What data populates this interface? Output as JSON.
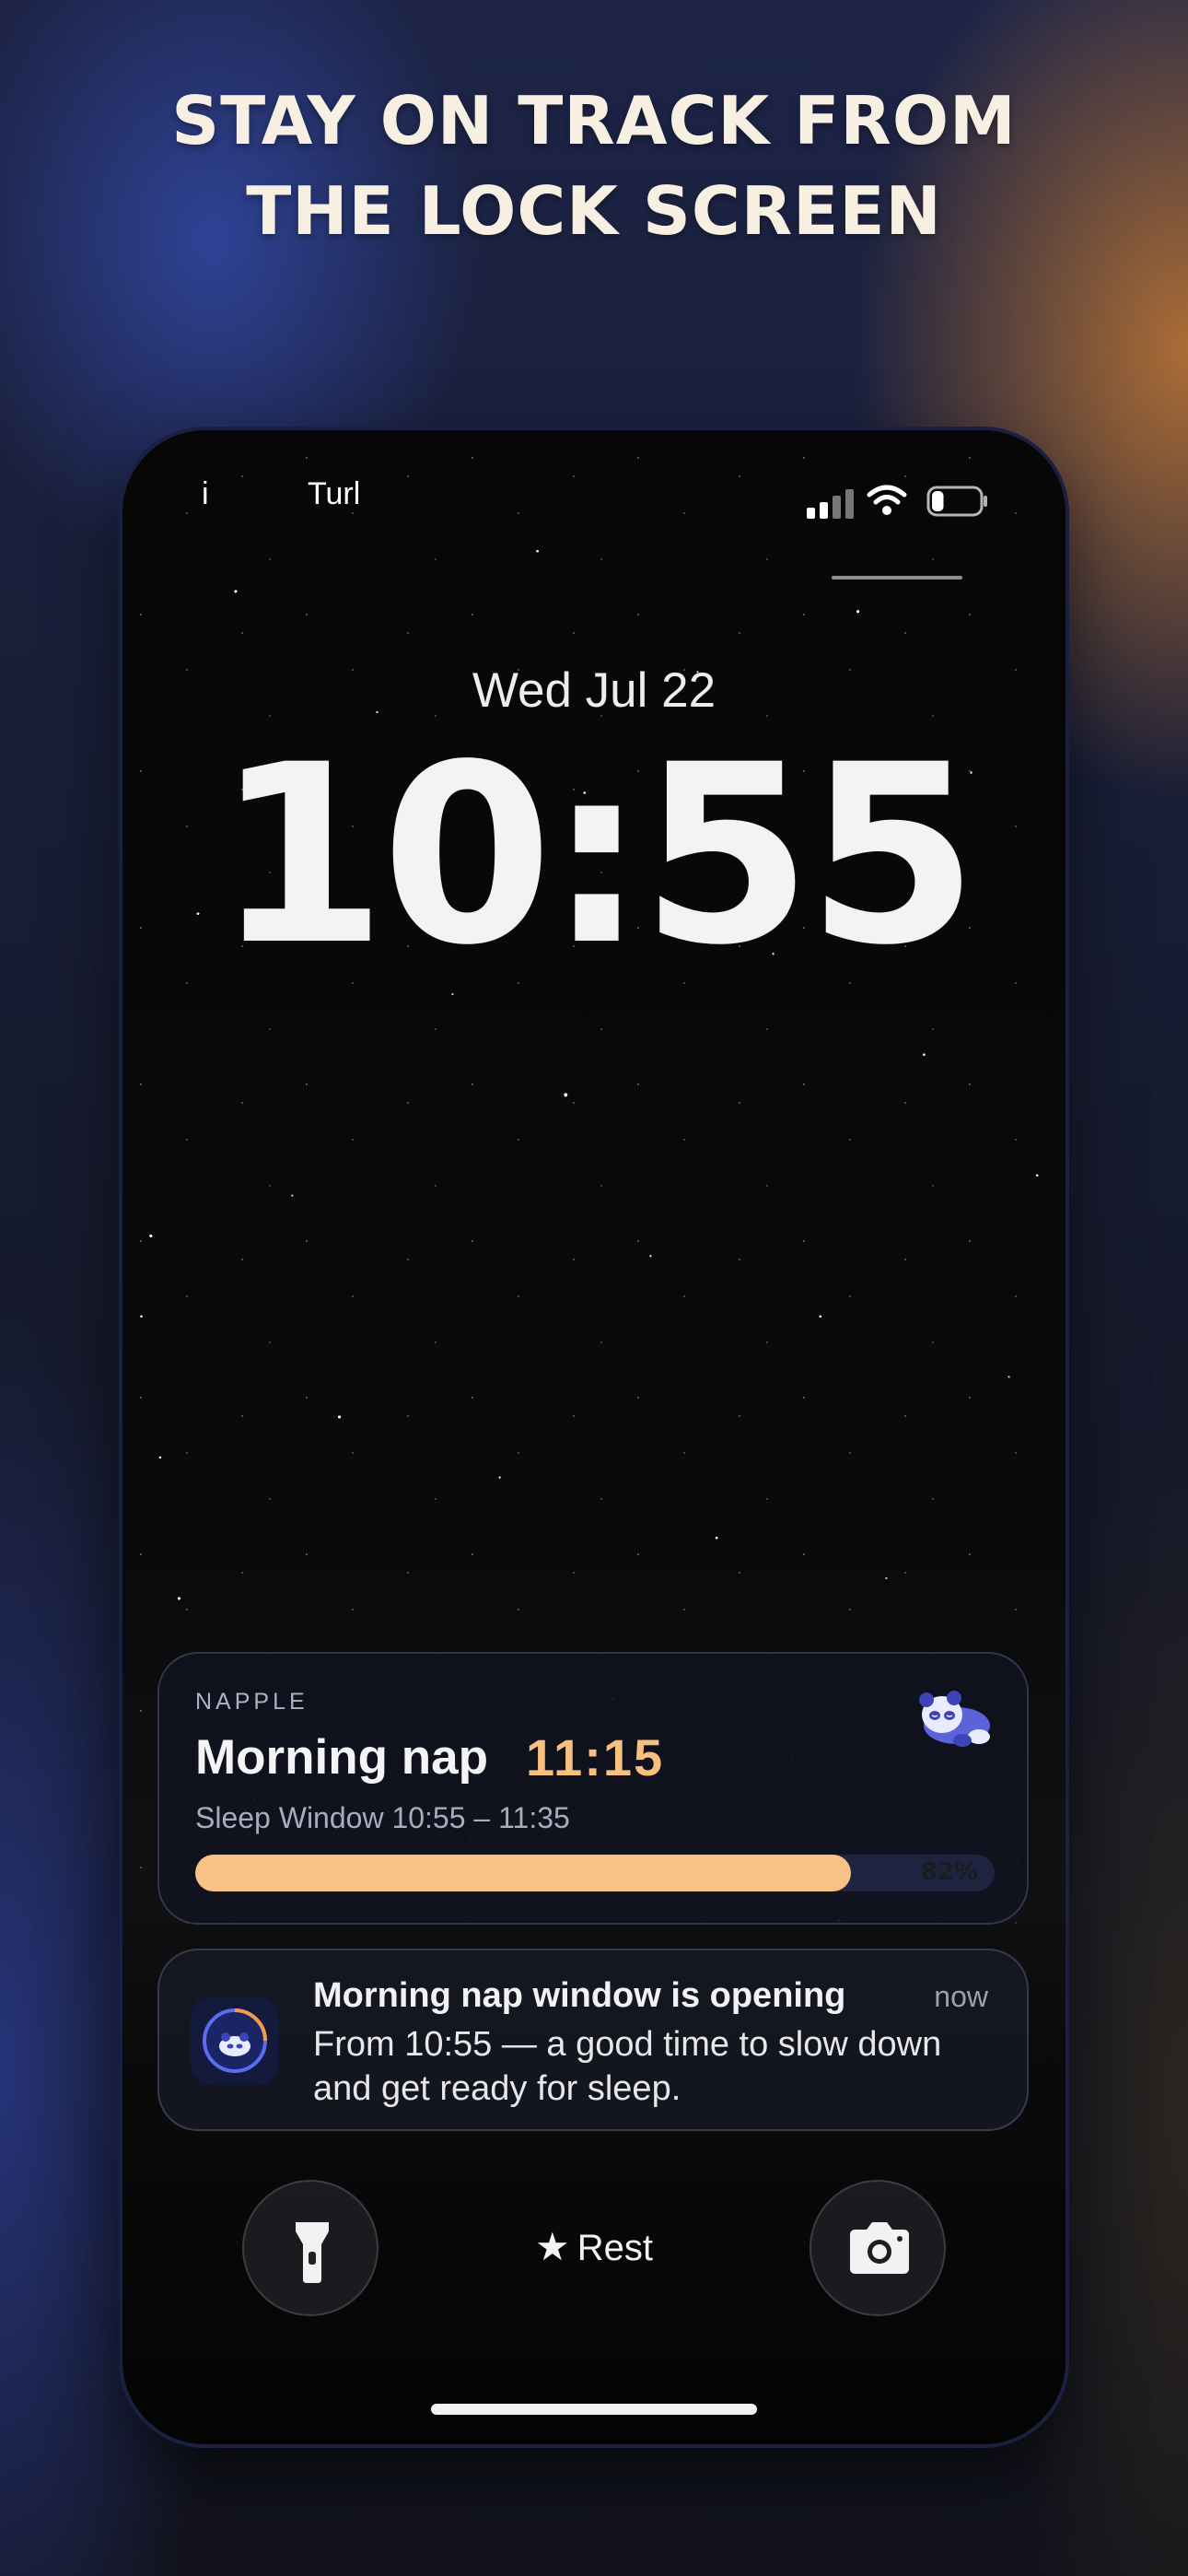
{
  "headline": {
    "line1": "STAY ON TRACK FROM",
    "line2": "THE LOCK SCREEN"
  },
  "status_bar": {
    "left_text": "i",
    "carrier": "Turl",
    "battery_level": 0.25
  },
  "lock_screen": {
    "date": "Wed Jul 22",
    "time": "10:55"
  },
  "live_activity": {
    "app_name": "NAPPLE",
    "title": "Morning nap",
    "end_time": "11:15",
    "subtitle": "Sleep Window 10:55 – 11:35",
    "progress_percent": 82,
    "progress_label": "82%",
    "mascot_icon": "sleeping-panda-icon"
  },
  "notification": {
    "title": "Morning nap window is opening",
    "time": "now",
    "body": "From 10:55 — a good time to slow down and get ready for sleep.",
    "app_icon": "clock-panda-icon"
  },
  "quick_actions": {
    "left_icon": "flashlight-icon",
    "focus_label": "Rest",
    "focus_icon": "star-icon",
    "right_icon": "camera-icon"
  },
  "colors": {
    "accent_orange": "#f7c07e",
    "progress_fill": "#f7c283",
    "progress_track": "#1e2440",
    "headline": "#f6efe2"
  }
}
